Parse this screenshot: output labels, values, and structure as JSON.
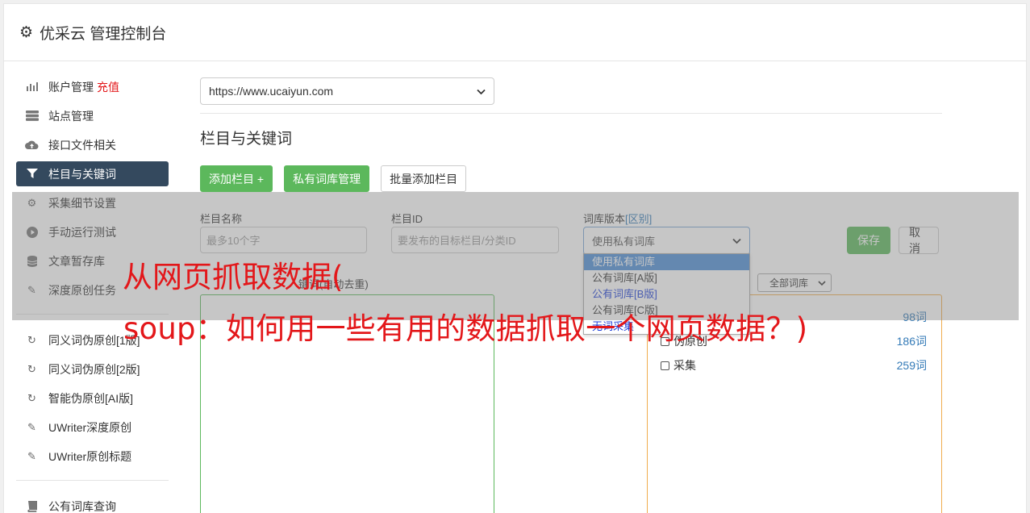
{
  "header": {
    "icon": "gear-icon",
    "title": "优采云 管理控制台"
  },
  "sidebar": {
    "items": [
      {
        "label": "账户管理",
        "extra": "充值",
        "icon": "bar-chart-icon"
      },
      {
        "label": "站点管理",
        "icon": "server-icon"
      },
      {
        "label": "接口文件相关",
        "icon": "cloud-upload-icon"
      },
      {
        "label": "栏目与关键词",
        "icon": "filter-icon",
        "active": true
      },
      {
        "label": "采集细节设置",
        "icon": "cogs-icon"
      },
      {
        "label": "手动运行测试",
        "icon": "play-circle-icon"
      },
      {
        "label": "文章暂存库",
        "icon": "database-icon"
      },
      {
        "label": "深度原创任务",
        "icon": "edit-icon"
      }
    ],
    "items2": [
      {
        "label": "同义词伪原创[1版]",
        "icon": "refresh-icon"
      },
      {
        "label": "同义词伪原创[2版]",
        "icon": "refresh-icon"
      },
      {
        "label": "智能伪原创[AI版]",
        "icon": "refresh-icon"
      },
      {
        "label": "UWriter深度原创",
        "icon": "edit-icon"
      },
      {
        "label": "UWriter原创标题",
        "icon": "edit-icon"
      }
    ],
    "items3": [
      {
        "label": "公有词库查询",
        "icon": "book-icon"
      }
    ]
  },
  "main": {
    "site_select": "https://www.ucaiyun.com",
    "section_title": "栏目与关键词",
    "buttons": {
      "add": "添加栏目 +",
      "private_lib": "私有词库管理",
      "batch_add": "批量添加栏目"
    },
    "form": {
      "name_label": "栏目名称",
      "name_placeholder": "最多10个字",
      "id_label": "栏目ID",
      "id_placeholder": "要发布的目标栏目/分类ID",
      "lib_label": "词库版本",
      "lib_label_link": "[区别]",
      "lib_value": "使用私有词库",
      "save": "保存",
      "cancel": "取消"
    },
    "dropdown": [
      "使用私有词库",
      "公有词库[A版]",
      "公有词库[B版]",
      "公有词库[C版]",
      "无词采集"
    ],
    "keywords_label": "键词(自动去重)",
    "lib_filter": "全部词库",
    "lib_rows": [
      {
        "label": "",
        "count": "98词"
      },
      {
        "label": "伪原创",
        "count": "186词"
      },
      {
        "label": "采集",
        "count": "259词"
      }
    ]
  },
  "watermark": {
    "line1": "从网页抓取数据(",
    "line2": "soup：如何用一些有用的数据抓取一个网页数据？)"
  },
  "colors": {
    "accent_green": "#5cb85c",
    "active_nav": "#34495e",
    "watermark": "#e3171a"
  }
}
